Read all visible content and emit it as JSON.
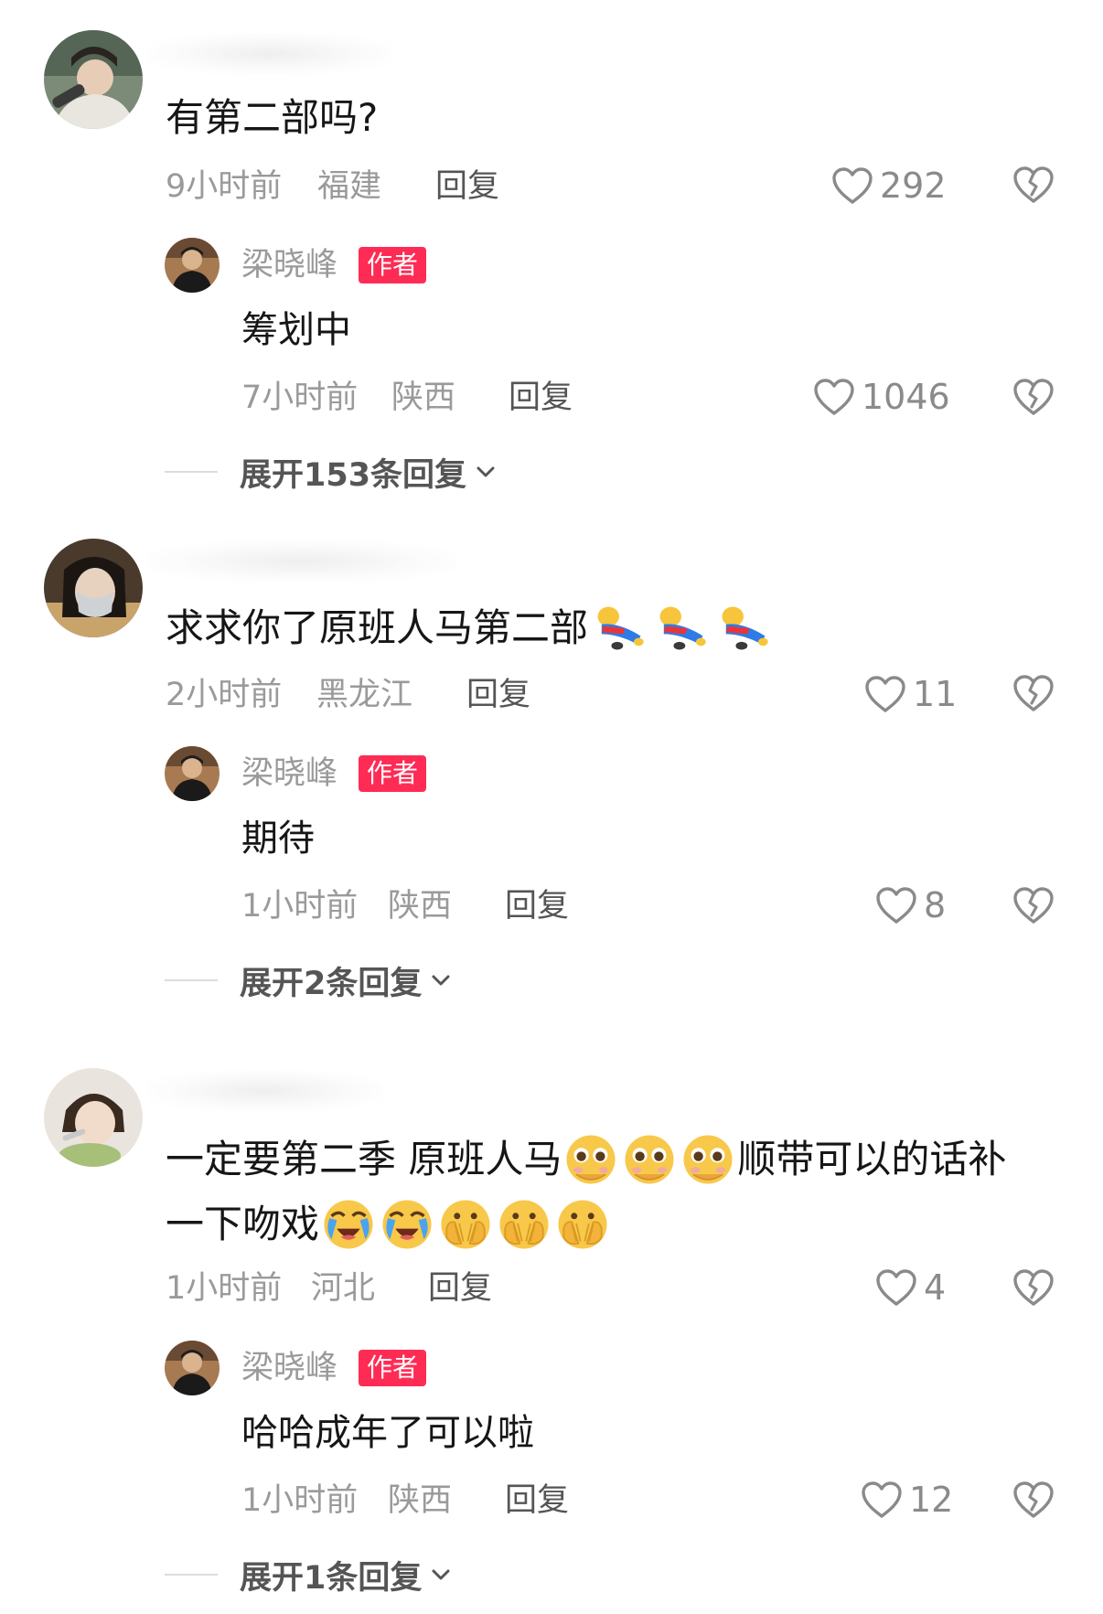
{
  "colors": {
    "author_badge": "#fe2c55",
    "meta_text": "#9a9a9a",
    "reply_text": "#555555",
    "body_text": "#161616"
  },
  "comments": [
    {
      "text": "有第二部吗?",
      "time": "9小时前",
      "location": "福建",
      "reply_label": "回复",
      "likes": "292",
      "reply": {
        "username": "梁晓峰",
        "badge": "作者",
        "text": "筹划中",
        "time": "7小时前",
        "location": "陕西",
        "reply_label": "回复",
        "likes": "1046"
      },
      "expand": "展开153条回复"
    },
    {
      "text": "求求你了原班人马第二部",
      "emojis": [
        "kneeling-emoji",
        "kneeling-emoji",
        "kneeling-emoji"
      ],
      "time": "2小时前",
      "location": "黑龙江",
      "reply_label": "回复",
      "likes": "11",
      "reply": {
        "username": "梁晓峰",
        "badge": "作者",
        "text": "期待",
        "time": "1小时前",
        "location": "陕西",
        "reply_label": "回复",
        "likes": "8"
      },
      "expand": "展开2条回复"
    },
    {
      "text_line1_a": "一定要第二季 原班人马",
      "text_line1_b": "顺带可以的话补",
      "text_line2": "一下吻戏",
      "time": "1小时前",
      "location": "河北",
      "reply_label": "回复",
      "likes": "4",
      "reply": {
        "username": "梁晓峰",
        "badge": "作者",
        "text": "哈哈成年了可以啦",
        "time": "1小时前",
        "location": "陕西",
        "reply_label": "回复",
        "likes": "12"
      },
      "expand": "展开1条回复"
    }
  ]
}
